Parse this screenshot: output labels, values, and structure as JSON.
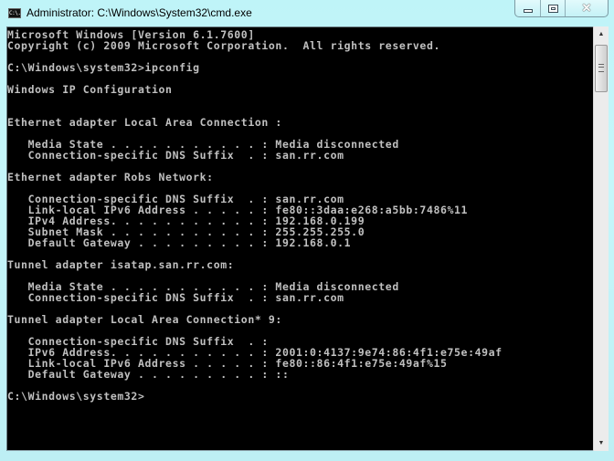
{
  "window": {
    "title": "Administrator: C:\\Windows\\System32\\cmd.exe",
    "icon": "cmd-icon",
    "icon_text": "C:\\.",
    "buttons": {
      "minimize": "minimize",
      "maximize": "maximize",
      "close": "✕"
    }
  },
  "console": {
    "lines": [
      "Microsoft Windows [Version 6.1.7600]",
      "Copyright (c) 2009 Microsoft Corporation.  All rights reserved.",
      "",
      "C:\\Windows\\system32>ipconfig",
      "",
      "Windows IP Configuration",
      "",
      "",
      "Ethernet adapter Local Area Connection :",
      "",
      "   Media State . . . . . . . . . . . : Media disconnected",
      "   Connection-specific DNS Suffix  . : san.rr.com",
      "",
      "Ethernet adapter Robs Network:",
      "",
      "   Connection-specific DNS Suffix  . : san.rr.com",
      "   Link-local IPv6 Address . . . . . : fe80::3daa:e268:a5bb:7486%11",
      "   IPv4 Address. . . . . . . . . . . : 192.168.0.199",
      "   Subnet Mask . . . . . . . . . . . : 255.255.255.0",
      "   Default Gateway . . . . . . . . . : 192.168.0.1",
      "",
      "Tunnel adapter isatap.san.rr.com:",
      "",
      "   Media State . . . . . . . . . . . : Media disconnected",
      "   Connection-specific DNS Suffix  . : san.rr.com",
      "",
      "Tunnel adapter Local Area Connection* 9:",
      "",
      "   Connection-specific DNS Suffix  . :",
      "   IPv6 Address. . . . . . . . . . . : 2001:0:4137:9e74:86:4f1:e75e:49af",
      "   Link-local IPv6 Address . . . . . : fe80::86:4f1:e75e:49af%15",
      "   Default Gateway . . . . . . . . . : ::",
      "",
      "C:\\Windows\\system32>"
    ],
    "prompt": "C:\\Windows\\system32>",
    "colors": {
      "background": "#000000",
      "foreground": "#c0c0c0"
    }
  },
  "scrollbar": {
    "up_arrow": "▲",
    "down_arrow": "▼",
    "position_fraction": 0.0
  }
}
